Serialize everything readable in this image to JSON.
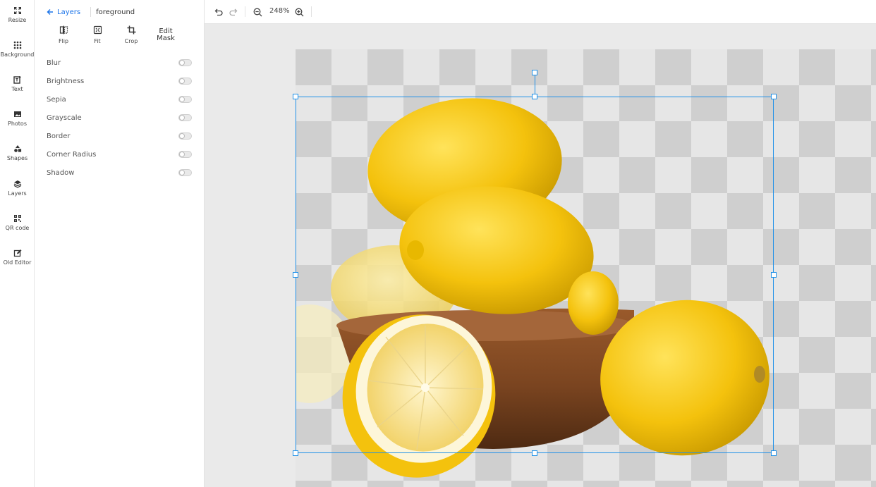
{
  "rail": [
    {
      "name": "resize",
      "label": "Resize",
      "icon": "resize-icon"
    },
    {
      "name": "background",
      "label": "Background",
      "icon": "dots-grid-icon"
    },
    {
      "name": "text",
      "label": "Text",
      "icon": "text-box-icon"
    },
    {
      "name": "photos",
      "label": "Photos",
      "icon": "image-icon"
    },
    {
      "name": "shapes",
      "label": "Shapes",
      "icon": "shapes-icon"
    },
    {
      "name": "layers",
      "label": "Layers",
      "icon": "layers-icon"
    },
    {
      "name": "qr-code",
      "label": "QR code",
      "icon": "qr-code-icon"
    },
    {
      "name": "old-editor",
      "label": "Old Editor",
      "icon": "edit-icon"
    }
  ],
  "panel": {
    "back_label": "Layers",
    "layer_name": "foreground",
    "tools": {
      "flip": "Flip",
      "fit": "Fit",
      "crop": "Crop",
      "edit_mask_line1": "Edit",
      "edit_mask_line2": "Mask"
    },
    "options": [
      {
        "label": "Blur",
        "enabled": false
      },
      {
        "label": "Brightness",
        "enabled": false
      },
      {
        "label": "Sepia",
        "enabled": false
      },
      {
        "label": "Grayscale",
        "enabled": false
      },
      {
        "label": "Border",
        "enabled": false
      },
      {
        "label": "Corner Radius",
        "enabled": false
      },
      {
        "label": "Shadow",
        "enabled": false
      }
    ]
  },
  "toolbar": {
    "zoom_level": "248%"
  },
  "colors": {
    "accent": "#1a73e8",
    "selection": "#1e90e8",
    "lemon": "#f5c400"
  }
}
